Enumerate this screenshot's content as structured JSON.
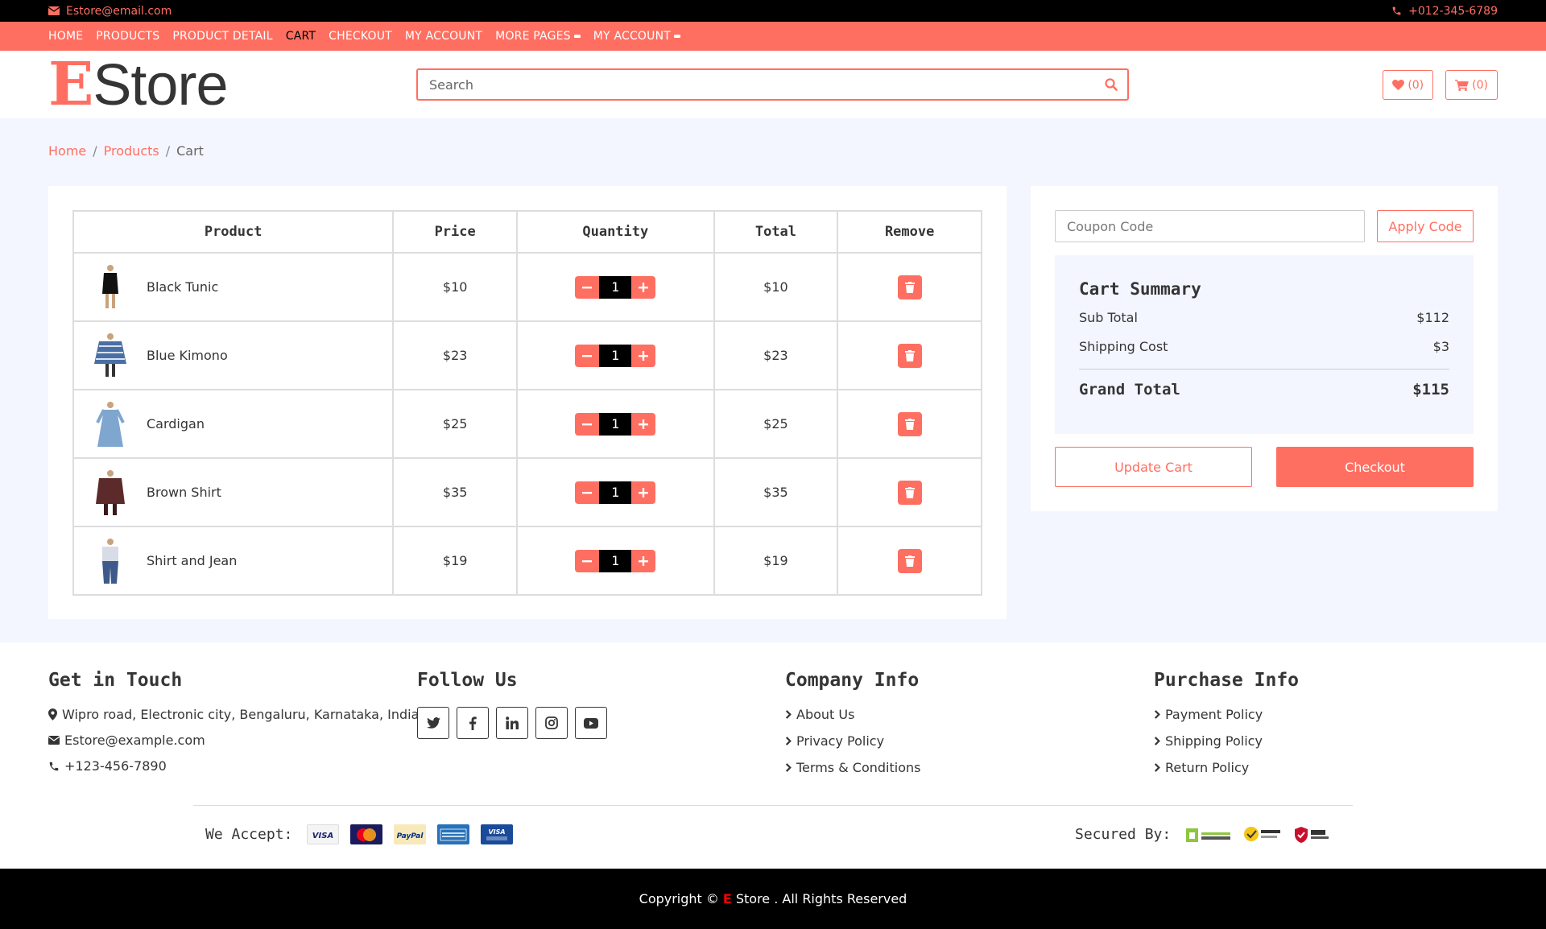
{
  "topbar": {
    "email": "Estore@email.com",
    "phone": "+012-345-6789"
  },
  "nav": {
    "items": [
      "HOME",
      "PRODUCTS",
      "PRODUCT DETAIL",
      "CART",
      "CHECKOUT",
      "MY ACCOUNT",
      "MORE PAGES",
      "MY ACCOUNT"
    ],
    "active": "CART"
  },
  "header": {
    "logo_first": "E",
    "logo_rest": "Store",
    "search_placeholder": "Search",
    "wishlist_count": "(0)",
    "cart_count": "(0)"
  },
  "breadcrumb": [
    "Home",
    "Products",
    "Cart"
  ],
  "cart": {
    "columns": [
      "Product",
      "Price",
      "Quantity",
      "Total",
      "Remove"
    ],
    "rows": [
      {
        "name": "Black Tunic",
        "price": "$10",
        "qty": "1",
        "total": "$10",
        "thumb": "black-tunic"
      },
      {
        "name": "Blue Kimono",
        "price": "$23",
        "qty": "1",
        "total": "$23",
        "thumb": "blue-kimono"
      },
      {
        "name": "Cardigan",
        "price": "$25",
        "qty": "1",
        "total": "$25",
        "thumb": "cardigan"
      },
      {
        "name": "Brown Shirt",
        "price": "$35",
        "qty": "1",
        "total": "$35",
        "thumb": "brown-shirt"
      },
      {
        "name": "Shirt and Jean",
        "price": "$19",
        "qty": "1",
        "total": "$19",
        "thumb": "shirt-and-jean"
      }
    ]
  },
  "summary": {
    "coupon_placeholder": "Coupon Code",
    "apply_label": "Apply Code",
    "title": "Cart Summary",
    "subtotal_label": "Sub Total",
    "subtotal": "$112",
    "shipping_label": "Shipping Cost",
    "shipping": "$3",
    "grand_label": "Grand Total",
    "grand": "$115",
    "update_label": "Update Cart",
    "checkout_label": "Checkout"
  },
  "footer": {
    "touch_title": "Get in Touch",
    "address": "Wipro road, Electronic city, Bengaluru, Karnataka, India",
    "email": "Estore@example.com",
    "phone": "+123-456-7890",
    "follow_title": "Follow Us",
    "social": [
      "twitter-icon",
      "facebook-icon",
      "linkedin-icon",
      "instagram-icon",
      "youtube-icon"
    ],
    "company_title": "Company Info",
    "company_links": [
      "About Us",
      "Privacy Policy",
      "Terms & Conditions"
    ],
    "purchase_title": "Purchase Info",
    "purchase_links": [
      "Payment Policy",
      "Shipping Policy",
      "Return Policy"
    ],
    "accept_label": "We Accept:",
    "secured_label": "Secured By:"
  },
  "copyright": {
    "prefix": "Copyright ©",
    "brand": "E",
    "suffix": "Store . All Rights Reserved"
  },
  "colors": {
    "accent": "#ff6f61",
    "dark": "#000000",
    "bg": "#f3f6ff"
  }
}
